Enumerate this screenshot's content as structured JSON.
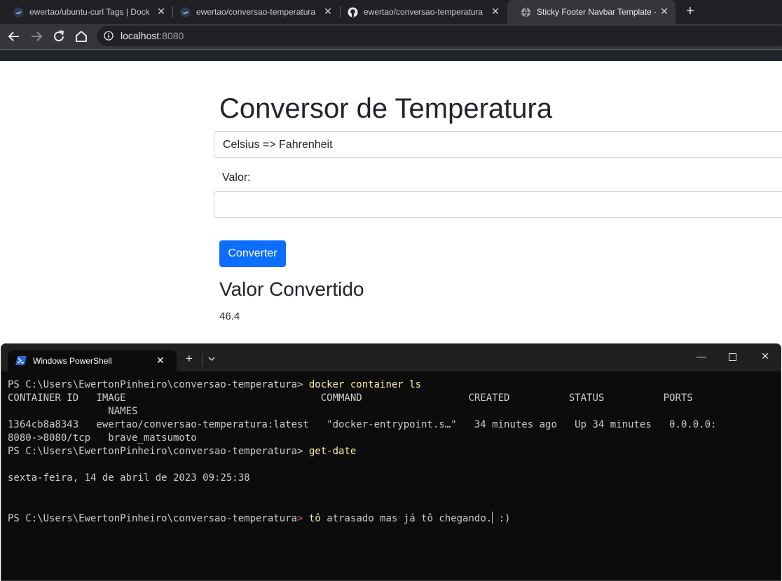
{
  "browser": {
    "tabs": [
      {
        "title": "ewertao/ubuntu-curl Tags | Dock",
        "favicon": "docker-icon"
      },
      {
        "title": "ewertao/conversao-temperatura",
        "favicon": "docker-icon"
      },
      {
        "title": "ewertao/conversao-temperatura",
        "favicon": "github-icon"
      },
      {
        "title": "Sticky Footer Navbar Template · B",
        "favicon": "globe-icon",
        "active": true
      }
    ],
    "url_host": "localhost",
    "url_port": ":8080"
  },
  "page": {
    "title": "Conversor de Temperatura",
    "select_value": "Celsius => Fahrenheit",
    "value_label": "Valor:",
    "value_input": "",
    "convert_button": "Converter",
    "result_title": "Valor Convertido",
    "result_value": "46.4"
  },
  "terminal": {
    "tab_title": "Windows PowerShell",
    "lines": {
      "l1_prompt": "PS C:\\Users\\EwertonPinheiro\\conversao-temperatura>",
      "l1_cmd": "docker container ls",
      "l2": "CONTAINER ID   IMAGE                                 COMMAND                  CREATED          STATUS          PORTS",
      "l3": "                 NAMES",
      "l4": "1364cb8a8343   ewertao/conversao-temperatura:latest   \"docker-entrypoint.s…\"   34 minutes ago   Up 34 minutes   0.0.0.0:",
      "l5": "8080->8080/tcp   brave_matsumoto",
      "l6_prompt": "PS C:\\Users\\EwertonPinheiro\\conversao-temperatura>",
      "l6_cmd": "get-date",
      "l7": "",
      "l8": "sexta-feira, 14 de abril de 2023 09:25:38",
      "l9": "",
      "l10": "",
      "l11_prompt": "PS C:\\Users\\EwertonPinheiro\\conversao-temperatura",
      "l11_arrow": ">",
      "l11_cmd": "tô",
      "l11_text_a": "atrasado mas já tô chegando.",
      "l11_text_b": " :)"
    }
  },
  "colors": {
    "primary_button": "#0d6efd",
    "terminal_command": "#f9f1a5",
    "terminal_prompt_arrow": "#e74856"
  }
}
